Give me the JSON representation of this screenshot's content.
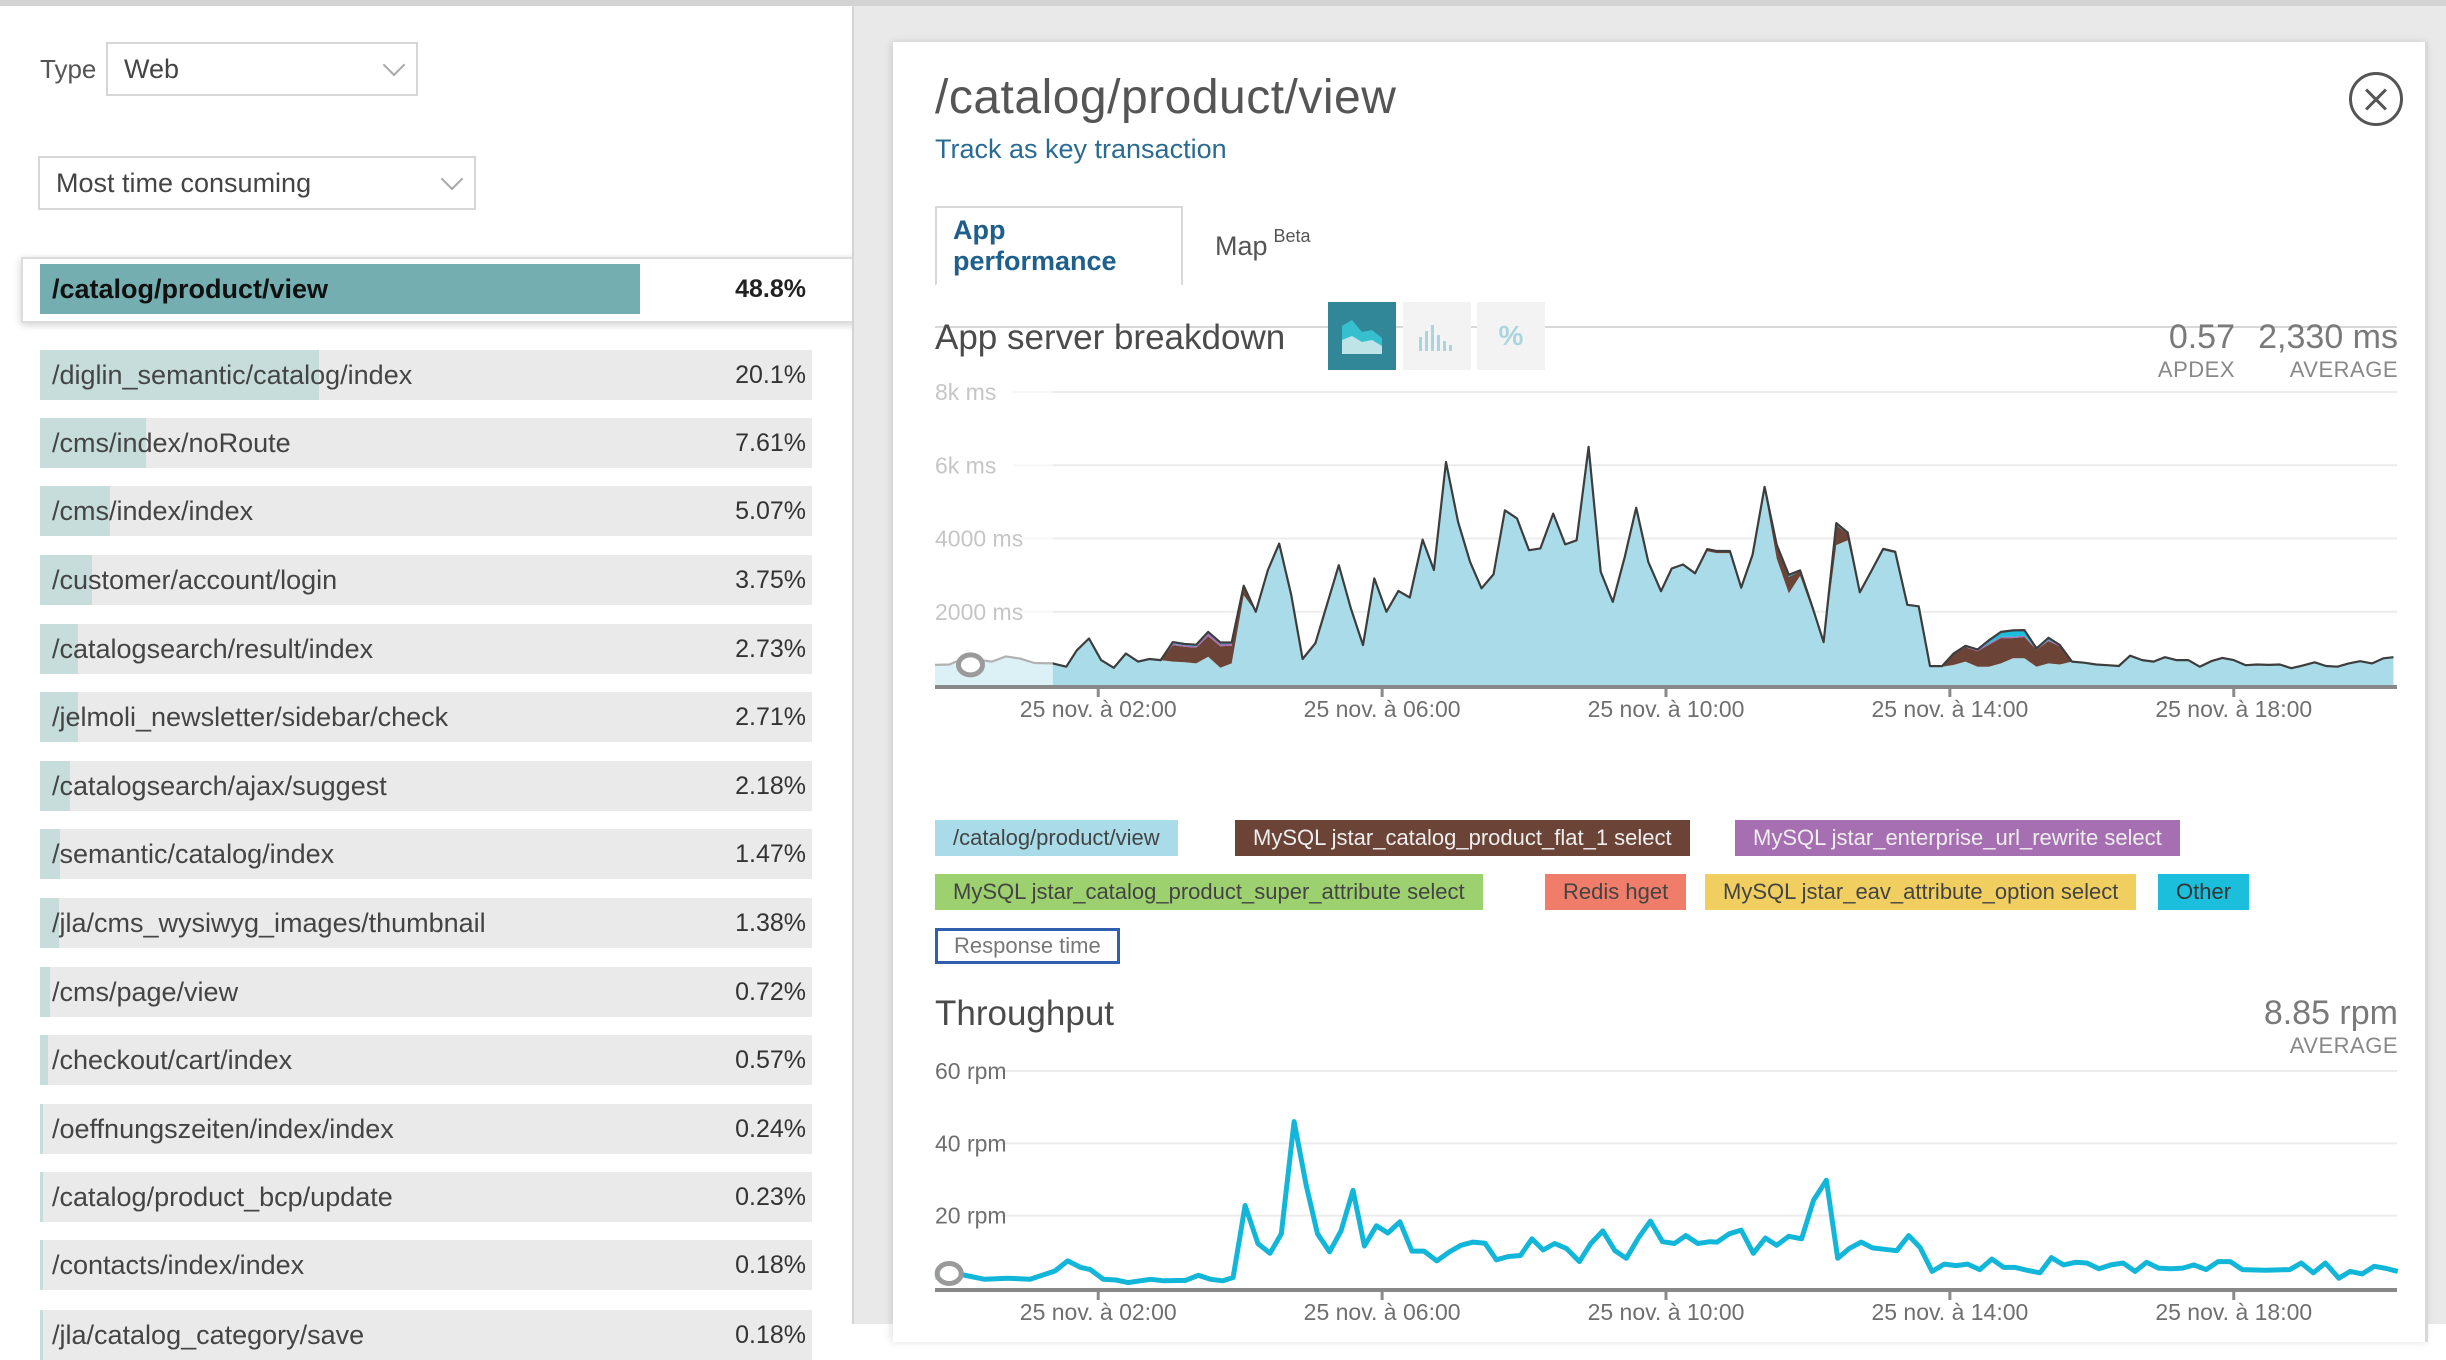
{
  "filters": {
    "type_label": "Type",
    "type_value": "Web",
    "sort_value": "Most time consuming"
  },
  "transactions": [
    {
      "name": "/catalog/product/view",
      "pct": "48.8%",
      "value": 48.8,
      "selected": true
    },
    {
      "name": "/diglin_semantic/catalog/index",
      "pct": "20.1%",
      "value": 20.1
    },
    {
      "name": "/cms/index/noRoute",
      "pct": "7.61%",
      "value": 7.61
    },
    {
      "name": "/cms/index/index",
      "pct": "5.07%",
      "value": 5.07
    },
    {
      "name": "/customer/account/login",
      "pct": "3.75%",
      "value": 3.75
    },
    {
      "name": "/catalogsearch/result/index",
      "pct": "2.73%",
      "value": 2.73
    },
    {
      "name": "/jelmoli_newsletter/sidebar/check",
      "pct": "2.71%",
      "value": 2.71
    },
    {
      "name": "/catalogsearch/ajax/suggest",
      "pct": "2.18%",
      "value": 2.18
    },
    {
      "name": "/semantic/catalog/index",
      "pct": "1.47%",
      "value": 1.47
    },
    {
      "name": "/jla/cms_wysiwyg_images/thumbnail",
      "pct": "1.38%",
      "value": 1.38
    },
    {
      "name": "/cms/page/view",
      "pct": "0.72%",
      "value": 0.72
    },
    {
      "name": "/checkout/cart/index",
      "pct": "0.57%",
      "value": 0.57
    },
    {
      "name": "/oeffnungszeiten/index/index",
      "pct": "0.24%",
      "value": 0.24
    },
    {
      "name": "/catalog/product_bcp/update",
      "pct": "0.23%",
      "value": 0.23
    },
    {
      "name": "/contacts/index/index",
      "pct": "0.18%",
      "value": 0.18
    },
    {
      "name": "/jla/catalog_category/save",
      "pct": "0.18%",
      "value": 0.18
    }
  ],
  "detail": {
    "title": "/catalog/product/view",
    "track_link": "Track as key transaction",
    "close_icon": "close-circle-icon",
    "tabs": [
      {
        "label": "App performance",
        "active": true
      },
      {
        "label": "Map",
        "badge": "Beta"
      }
    ],
    "breakdown": {
      "title": "App server breakdown",
      "view_buttons": [
        {
          "icon": "area-chart-icon",
          "active": true
        },
        {
          "icon": "bar-chart-icon"
        },
        {
          "icon": "percent-icon",
          "glyph": "%"
        }
      ],
      "apdex_value": "0.57",
      "apdex_label": "APDEX",
      "avg_value": "2,330 ms",
      "avg_label": "AVERAGE"
    },
    "legend": [
      {
        "label": "/catalog/product/view",
        "color": "#a9dce8",
        "text_color": "#444"
      },
      {
        "label": "MySQL jstar_catalog_product_flat_1 select",
        "color": "#6b4437",
        "text_color": "#eee"
      },
      {
        "label": "MySQL jstar_enterprise_url_rewrite select",
        "color": "#a66fb2",
        "text_color": "#eee"
      },
      {
        "label": "MySQL jstar_catalog_product_super_attribute select",
        "color": "#9dd06f",
        "text_color": "#444"
      },
      {
        "label": "Redis hget",
        "color": "#ef7d69",
        "text_color": "#444"
      },
      {
        "label": "MySQL jstar_eav_attribute_option select",
        "color": "#f0cf60",
        "text_color": "#444"
      },
      {
        "label": "Other",
        "color": "#1bbfdc",
        "text_color": "#333"
      },
      {
        "label": "Response time",
        "color": "#ffffff",
        "text_color": "#777",
        "border": "#2f5fae"
      }
    ],
    "throughput": {
      "title": "Throughput",
      "avg_value": "8.85 rpm",
      "avg_label": "AVERAGE"
    }
  },
  "chart_data": [
    {
      "type": "area",
      "title": "App server breakdown",
      "ylabel": "ms",
      "ylim": [
        0,
        8000
      ],
      "yticks": [
        2000,
        4000,
        6000,
        8000
      ],
      "ytick_labels": [
        "2000 ms",
        "4000 ms",
        "6k ms",
        "8k ms"
      ],
      "xlim_hours": [
        -0.3,
        20.3
      ],
      "xticks_hours": [
        2,
        6,
        10,
        14,
        18
      ],
      "xtick_labels": [
        "25 nov. à 02:00",
        "25 nov. à 06:00",
        "25 nov. à 10:00",
        "25 nov. à 14:00",
        "25 nov. à 18:00"
      ],
      "faded_until_hours": 1.36,
      "grid": true,
      "stacked": true,
      "x_hours": [
        -0.3,
        -0.1,
        0.1,
        0.3,
        0.5,
        0.7,
        0.9,
        1.1,
        1.36,
        1.55,
        1.7,
        1.87,
        2.04,
        2.22,
        2.39,
        2.56,
        2.72,
        2.88,
        3.05,
        3.22,
        3.38,
        3.55,
        3.72,
        3.88,
        4.05,
        4.22,
        4.39,
        4.55,
        4.72,
        4.88,
        5.06,
        5.22,
        5.39,
        5.56,
        5.73,
        5.89,
        6.06,
        6.23,
        6.39,
        6.57,
        6.73,
        6.9,
        7.07,
        7.24,
        7.4,
        7.57,
        7.73,
        7.9,
        8.07,
        8.23,
        8.41,
        8.58,
        8.74,
        8.91,
        9.08,
        9.25,
        9.42,
        9.58,
        9.75,
        9.93,
        10.08,
        10.24,
        10.41,
        10.58,
        10.71,
        10.9,
        11.06,
        11.22,
        11.39,
        11.56,
        11.73,
        11.89,
        12.06,
        12.22,
        12.4,
        12.56,
        12.73,
        12.89,
        13.06,
        13.23,
        13.4,
        13.56,
        13.72,
        13.89,
        14.05,
        14.22,
        14.39,
        14.55,
        14.72,
        14.89,
        15.05,
        15.22,
        15.39,
        15.55,
        15.72,
        15.89,
        16.06,
        16.22,
        16.38,
        16.54,
        16.71,
        16.87,
        17.03,
        17.19,
        17.36,
        17.52,
        17.68,
        17.84,
        18.0,
        18.17,
        18.33,
        18.49,
        18.65,
        18.81,
        18.97,
        19.14,
        19.3,
        19.46,
        19.62,
        19.78,
        19.95,
        20.11,
        20.25
      ],
      "series": [
        {
          "name": "/catalog/product/view",
          "values": [
            550,
            560,
            720,
            690,
            640,
            780,
            720,
            600,
            590,
            500,
            950,
            1270,
            680,
            470,
            860,
            640,
            710,
            680,
            640,
            620,
            590,
            770,
            470,
            590,
            2450,
            2000,
            3140,
            3860,
            2450,
            710,
            1140,
            2180,
            3270,
            2090,
            1090,
            2910,
            2000,
            2570,
            2390,
            3970,
            3140,
            6090,
            4450,
            3360,
            2640,
            3020,
            4770,
            4550,
            3680,
            3730,
            4680,
            3840,
            3950,
            6500,
            3090,
            2270,
            3500,
            4840,
            3360,
            2560,
            3180,
            3290,
            3050,
            3650,
            3600,
            3600,
            2600,
            3480,
            5300,
            3450,
            2500,
            2980,
            2050,
            1150,
            3820,
            3950,
            2500,
            3080,
            3680,
            3600,
            2180,
            2140,
            500,
            500,
            545,
            640,
            500,
            500,
            590,
            730,
            730,
            500,
            590,
            560,
            640,
            610,
            560,
            540,
            520,
            800,
            680,
            640,
            760,
            680,
            680,
            500,
            650,
            740,
            680,
            540,
            560,
            550,
            560,
            460,
            530,
            620,
            520,
            500,
            590,
            650,
            590,
            730,
            760
          ]
        },
        {
          "name": "MySQL jstar_catalog_product_flat_1 select",
          "values": [
            0,
            0,
            0,
            0,
            0,
            0,
            0,
            0,
            0,
            0,
            0,
            0,
            0,
            0,
            0,
            0,
            0,
            0,
            450,
            420,
            430,
            560,
            590,
            480,
            260,
            0,
            0,
            0,
            0,
            0,
            0,
            0,
            0,
            0,
            0,
            0,
            0,
            0,
            0,
            0,
            0,
            0,
            0,
            0,
            0,
            0,
            0,
            0,
            0,
            0,
            0,
            0,
            0,
            0,
            0,
            0,
            0,
            0,
            0,
            0,
            0,
            0,
            0,
            40,
            40,
            40,
            60,
            50,
            90,
            330,
            450,
            130,
            100,
            20,
            540,
            180,
            30,
            20,
            40,
            40,
            10,
            10,
            15,
            15,
            300,
            390,
            420,
            600,
            690,
            550,
            580,
            460,
            610,
            490,
            0,
            0,
            0,
            0,
            0,
            0,
            0,
            0,
            0,
            0,
            0,
            0,
            0,
            0,
            0,
            0,
            0,
            0,
            0,
            0,
            0,
            0,
            0,
            0,
            0,
            0,
            0,
            0,
            0
          ]
        },
        {
          "name": "MySQL jstar_enterprise_url_rewrite select",
          "values": [
            0,
            0,
            0,
            0,
            0,
            0,
            0,
            0,
            0,
            0,
            0,
            0,
            0,
            0,
            0,
            0,
            0,
            0,
            40,
            40,
            40,
            80,
            60,
            50,
            0,
            0,
            0,
            0,
            0,
            0,
            0,
            0,
            0,
            0,
            0,
            0,
            0,
            0,
            0,
            0,
            0,
            0,
            0,
            0,
            0,
            0,
            0,
            0,
            0,
            0,
            0,
            0,
            0,
            0,
            0,
            0,
            0,
            0,
            0,
            0,
            0,
            0,
            0,
            0,
            0,
            0,
            0,
            0,
            0,
            0,
            0,
            0,
            0,
            0,
            0,
            0,
            0,
            0,
            0,
            0,
            0,
            0,
            0,
            0,
            10,
            20,
            30,
            40,
            40,
            40,
            40,
            20,
            30,
            20,
            0,
            0,
            0,
            0,
            0,
            0,
            0,
            0,
            0,
            0,
            0,
            0,
            0,
            0,
            0,
            0,
            0,
            0,
            0,
            0,
            0,
            0,
            0,
            0,
            0,
            0,
            0,
            0,
            0
          ]
        },
        {
          "name": "Other",
          "values": [
            0,
            0,
            0,
            0,
            0,
            0,
            0,
            0,
            0,
            0,
            0,
            0,
            0,
            0,
            0,
            0,
            0,
            0,
            40,
            40,
            40,
            40,
            40,
            40,
            0,
            0,
            0,
            0,
            0,
            0,
            0,
            0,
            0,
            0,
            0,
            0,
            0,
            0,
            0,
            0,
            0,
            0,
            0,
            0,
            0,
            0,
            0,
            0,
            0,
            0,
            0,
            0,
            0,
            0,
            0,
            0,
            0,
            0,
            0,
            0,
            0,
            0,
            0,
            20,
            20,
            20,
            0,
            30,
            20,
            50,
            60,
            20,
            0,
            0,
            60,
            30,
            0,
            0,
            0,
            0,
            0,
            0,
            0,
            0,
            0,
            20,
            20,
            80,
            130,
            170,
            150,
            20,
            60,
            20,
            0,
            0,
            0,
            0,
            0,
            0,
            0,
            0,
            0,
            0,
            0,
            0,
            0,
            0,
            0,
            0,
            0,
            0,
            0,
            0,
            0,
            0,
            0,
            0,
            0,
            0,
            0,
            0,
            0
          ]
        }
      ]
    },
    {
      "type": "line",
      "title": "Throughput",
      "ylabel": "rpm",
      "ylim": [
        0,
        60
      ],
      "yticks": [
        20,
        40,
        60
      ],
      "ytick_labels": [
        "20 rpm",
        "40 rpm",
        "60 rpm"
      ],
      "xlim_hours": [
        -0.3,
        20.3
      ],
      "xticks_hours": [
        2,
        6,
        10,
        14,
        18
      ],
      "xtick_labels": [
        "25 nov. à 02:00",
        "25 nov. à 06:00",
        "25 nov. à 10:00",
        "25 nov. à 14:00",
        "25 nov. à 18:00"
      ],
      "faded_until_hours": 0.25,
      "grid": true,
      "series": [
        {
          "name": "Throughput",
          "color": "#12b6d8",
          "x_hours": [
            -0.3,
            0.0,
            0.4,
            0.72,
            1.04,
            1.39,
            1.57,
            1.75,
            1.89,
            2.07,
            2.25,
            2.42,
            2.74,
            2.92,
            3.23,
            3.41,
            3.58,
            3.76,
            3.9,
            4.07,
            4.25,
            4.42,
            4.58,
            4.76,
            4.93,
            5.09,
            5.26,
            5.42,
            5.59,
            5.75,
            5.92,
            6.08,
            6.25,
            6.42,
            6.59,
            6.77,
            6.95,
            7.11,
            7.28,
            7.45,
            7.61,
            7.78,
            7.95,
            8.11,
            8.27,
            8.43,
            8.6,
            8.78,
            8.94,
            9.11,
            9.28,
            9.44,
            9.61,
            9.78,
            9.95,
            10.12,
            10.28,
            10.45,
            10.62,
            10.72,
            10.89,
            11.06,
            11.23,
            11.4,
            11.56,
            11.73,
            11.91,
            12.08,
            12.26,
            12.42,
            12.58,
            12.75,
            12.91,
            13.08,
            13.25,
            13.42,
            13.58,
            13.75,
            13.92,
            14.09,
            14.25,
            14.42,
            14.59,
            14.76,
            14.92,
            15.09,
            15.27,
            15.43,
            15.6,
            15.77,
            15.93,
            16.1,
            16.27,
            16.44,
            16.61,
            16.77,
            16.94,
            17.11,
            17.28,
            17.44,
            17.61,
            17.78,
            17.95,
            18.12,
            18.45,
            18.79,
            18.95,
            19.12,
            19.29,
            19.48,
            19.64,
            19.81,
            19.98,
            20.15,
            20.31
          ],
          "values": [
            2.9,
            4.0,
            2.4,
            2.7,
            2.4,
            4.7,
            7.5,
            5.7,
            5.1,
            2.4,
            2.2,
            1.5,
            2.4,
            2.0,
            2.1,
            3.5,
            2.4,
            2.0,
            2.9,
            22.8,
            12.3,
            9.6,
            15.0,
            46.0,
            28.4,
            15.0,
            10.0,
            15.8,
            27.0,
            11.6,
            17.2,
            15.2,
            18.3,
            10.2,
            10.2,
            7.5,
            10.0,
            11.8,
            12.7,
            12.4,
            7.8,
            8.7,
            9.0,
            13.6,
            10.5,
            12.3,
            10.9,
            7.3,
            12.3,
            15.8,
            10.3,
            8.2,
            13.8,
            18.5,
            12.8,
            12.3,
            14.5,
            12.3,
            12.8,
            12.7,
            15.0,
            16.0,
            9.6,
            13.8,
            11.8,
            14.3,
            13.6,
            24.3,
            29.8,
            8.2,
            10.9,
            12.7,
            11.1,
            10.7,
            10.3,
            14.5,
            11.2,
            4.6,
            6.6,
            6.2,
            6.6,
            5.1,
            8.0,
            5.7,
            5.7,
            4.9,
            4.2,
            8.4,
            6.4,
            7.1,
            6.9,
            5.3,
            6.4,
            6.9,
            4.6,
            7.1,
            5.5,
            5.3,
            5.5,
            6.4,
            5.1,
            7.3,
            7.3,
            5.1,
            4.9,
            5.1,
            6.9,
            4.2,
            6.9,
            2.7,
            4.6,
            3.9,
            6.0,
            5.4,
            4.6
          ]
        }
      ]
    }
  ]
}
